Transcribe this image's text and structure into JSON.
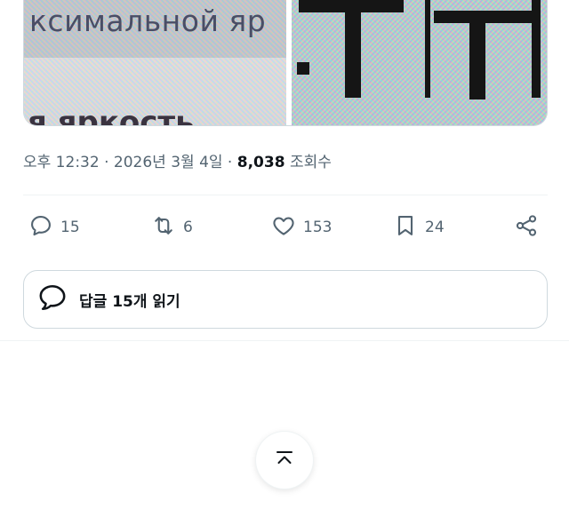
{
  "media": {
    "left_text_line1": "ксимальной яр",
    "left_text_line2": "я яркость"
  },
  "meta": {
    "time": "오후 12:32",
    "separator": " · ",
    "date": "2026년 3월 4일",
    "views_count": "8,038",
    "views_label": "조회수"
  },
  "actions": {
    "replies": "15",
    "reposts": "6",
    "likes": "153",
    "bookmarks": "24"
  },
  "read_replies": {
    "label": "답글 15개 읽기"
  },
  "icons": {
    "reply": "reply-bubble-icon",
    "repost": "repost-arrows-icon",
    "like": "heart-icon",
    "bookmark": "bookmark-icon",
    "share": "share-nodes-icon",
    "read_replies": "speech-bubble-icon",
    "to_top": "chevron-up-bar-icon"
  },
  "colors": {
    "text_primary": "#0f1419",
    "text_secondary": "#536471",
    "border": "#cfd9de"
  }
}
